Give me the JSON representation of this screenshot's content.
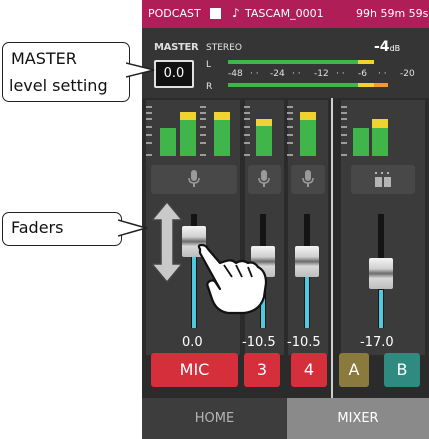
{
  "statusbar": {
    "mode": "PODCAST",
    "note_icon": "♪",
    "file": "TASCAM_0001",
    "time": "99h 59m 59s"
  },
  "master": {
    "label": "MASTER",
    "value": "0.0",
    "stereo_label": "STEREO",
    "peak_db": "-4",
    "db_unit": "dB",
    "channel_left": "L",
    "channel_right": "R",
    "scale": [
      "-48",
      "-24",
      "-12",
      "-6",
      "-20"
    ]
  },
  "channels": [
    {
      "icon": "microphone-icon",
      "value": "0.0",
      "button": "MIC",
      "button_color": "#d62f3c"
    },
    {
      "icon": "microphone-icon",
      "value": "-10.5",
      "button": "3",
      "button_color": "#d62f3c"
    },
    {
      "icon": "microphone-icon",
      "value": "-10.5",
      "button": "4",
      "button_color": "#d62f3c"
    },
    {
      "icon": "stereo-pair-icon",
      "value": "-17.0",
      "button_a": "A",
      "button_b": "B",
      "color_a": "#8b7a3e",
      "color_b": "#2f8b80"
    }
  ],
  "tabs": {
    "home": "HOME",
    "mixer": "MIXER",
    "active": "MIXER"
  },
  "callouts": {
    "master_line1": "MASTER",
    "master_line2": "level setting",
    "faders": "Faders"
  },
  "colors": {
    "accent": "#b01e58",
    "fader_fill": "#4ec9df",
    "meter_green": "#3fb54a",
    "meter_yellow": "#f0d331",
    "meter_orange": "#f29a2e"
  }
}
